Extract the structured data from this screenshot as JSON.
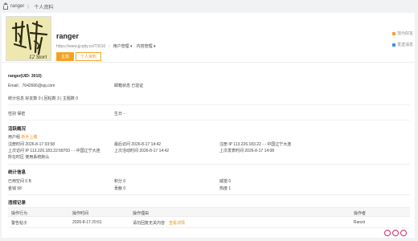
{
  "breadcrumb": {
    "root": "ranger",
    "sep": "〉",
    "current": "个人资料"
  },
  "profile": {
    "name": "ranger",
    "url": "https://www.jjcqtty.cn/?3010",
    "menu1": "用户管理",
    "menu2": "内容管理",
    "tab_active": "主题",
    "tab_other": "个人资料",
    "action1": "加为好友",
    "action2": "发送消息",
    "avatar_text": "12 Stori"
  },
  "basic": {
    "uid_line": "ranger(UID: 3010)",
    "email": "Email：7642666@qq.com",
    "email_status": "邮箱状态  已验证",
    "stats": "统计信息 好友数 0 | 回帖数 3 | 主题数 0",
    "gender": "性别   保密",
    "birthday": "生日   -"
  },
  "activity": {
    "title": "活跃概况",
    "group_label": "用户组",
    "group_value": "新手上路",
    "reg_time": "注册时间   2026-8-17 03:58",
    "last_visit": "最后访问   2026-8-17 14:42",
    "reg_ip": "注册 IP   113.226.183.22 - - 中国辽宁大连",
    "last_ip": "上次访问 IP   113.226.183.22:58703 - - 中国辽宁大连",
    "last_active": "上次活动时间   2026-8-17 14:42",
    "last_post": "上次发表时间   2026-8-17 14:08",
    "timezone": "所在时区   使用系统默认"
  },
  "stats_info": {
    "title": "统计信息",
    "space": "已用空间   0 B",
    "points": "积分   0",
    "prestige": "威望   0",
    "money": "金钱   58",
    "contribution": "贡献   0",
    "coins": "热度   1"
  },
  "ops": {
    "title": "违规记录",
    "headers": [
      "操作行为",
      "操作时间",
      "操作理由",
      "操作者"
    ],
    "row": {
      "action": "警告帖子",
      "time": "2026-8-17 20:51",
      "reason": "请勿回复无关内容",
      "reason_link": "查看详情",
      "operator": "Ranzii"
    }
  },
  "colors": {
    "accent": "#f5a01e",
    "link": "#f08c1a"
  }
}
